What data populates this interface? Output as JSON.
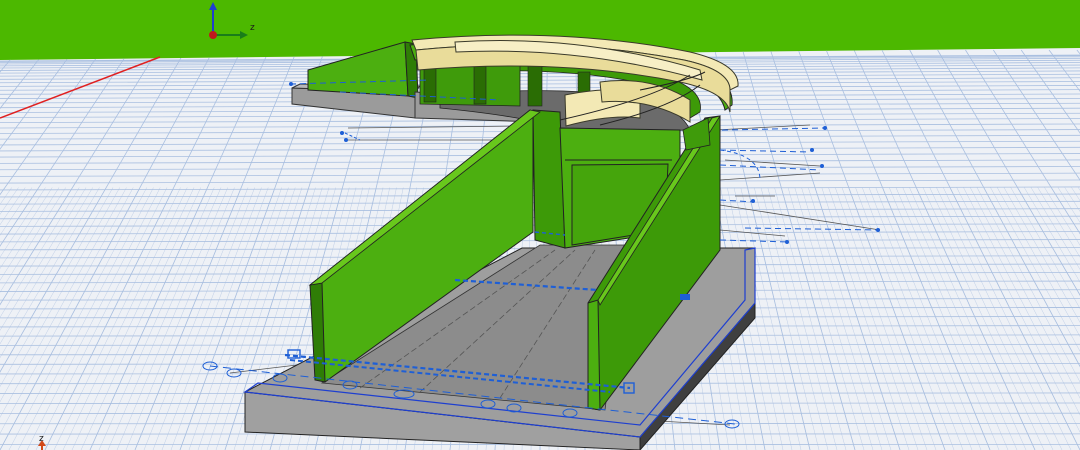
{
  "viewport": {
    "sky_color": "#4cb800",
    "ground_color": "#eef1f6",
    "grid_color": "#a9bfe0",
    "wall_color": "#4caf10",
    "wall_dark": "#2f7d06",
    "slab_color": "#a3a3a3",
    "parapet_color": "#f3e9b5",
    "axis_line_color": "#1e5fd6"
  },
  "triad": {
    "z_label": "z"
  },
  "corner_triad": {
    "z_label": "z"
  }
}
